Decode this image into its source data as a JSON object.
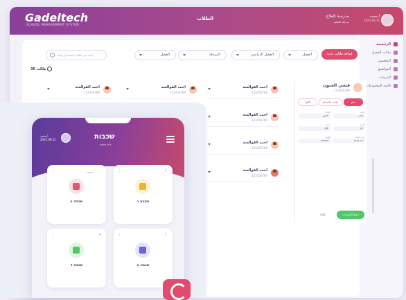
{
  "app": {
    "logo": "Gadeltech",
    "logo_sub": "SCHOOL MANAGEMENT SYSTEM",
    "title": "الطلاب",
    "school_name": "مدرسة الفلاح",
    "school_sub": "مرحلة التعليم",
    "user_name": "أ.محمد",
    "user_date": "2021.09.11"
  },
  "sidebar": {
    "items": [
      {
        "label": "الرئيسية",
        "active": true
      },
      {
        "label": "بيانات الفصل",
        "active": false
      },
      {
        "label": "المعلمون",
        "active": false
      },
      {
        "label": "المواضيع",
        "active": false
      },
      {
        "label": "الدرجات",
        "active": false
      },
      {
        "label": "قائمة المجموعات",
        "active": false
      }
    ]
  },
  "toolbar": {
    "search_placeholder": "ابحث عن طالب باسمه او رقمه",
    "filter_term": "الفصل",
    "filter_semester": "الفصل الدراسي",
    "filter_stage": "المرحلة",
    "filter_class": "الفصل",
    "add_button": "إضافة طالب جديد"
  },
  "student_count": "36 طالب",
  "students": [
    {
      "name": "احمد الفوالشة",
      "id": "123456789"
    },
    {
      "name": "احمد الفوالشة",
      "id": "123456789"
    },
    {
      "name": "احمد الفوالشة",
      "id": "123456789"
    },
    {
      "name": "احمد الفوالشة",
      "id": "123456789"
    },
    {
      "name": "احمد الفوالشة",
      "id": "123456789"
    },
    {
      "name": "احمد الفوالشة",
      "id": "123456789"
    },
    {
      "name": "احمد الفوالشة",
      "id": "123456789"
    }
  ],
  "detail": {
    "name": "فتحي الحنون",
    "id": "123456789",
    "tabs": [
      "عام",
      "بيانات الاتصال",
      "الأهل"
    ],
    "fields": [
      {
        "label": "الاسم",
        "value": "فتحي"
      },
      {
        "label": "العائلة",
        "value": "الحنون"
      },
      {
        "label": "الجنس",
        "value": "ذكر"
      },
      {
        "label": "الصف",
        "value": "الأول"
      },
      {
        "label": "تاريخ الميلاد",
        "value": "2010.1.1"
      },
      {
        "label": "الهوية",
        "value": "123456"
      }
    ],
    "save": "حفظ التغييرات",
    "cancel": "إلغاء"
  },
  "phone": {
    "title": "שכבות",
    "subtitle": "לוח זמנים",
    "user": "أ.محمد",
    "user_sub": "2021.09.11",
    "cards": [
      {
        "label": "שכבה ג",
        "color": "#f0b429"
      },
      {
        "label": "שכבה ב",
        "color": "#e2566e",
        "note": "2 כיתות"
      },
      {
        "label": "שכבה ה",
        "color": "#6c63d9"
      },
      {
        "label": "שכבה ד",
        "color": "#4fc86a"
      }
    ]
  }
}
